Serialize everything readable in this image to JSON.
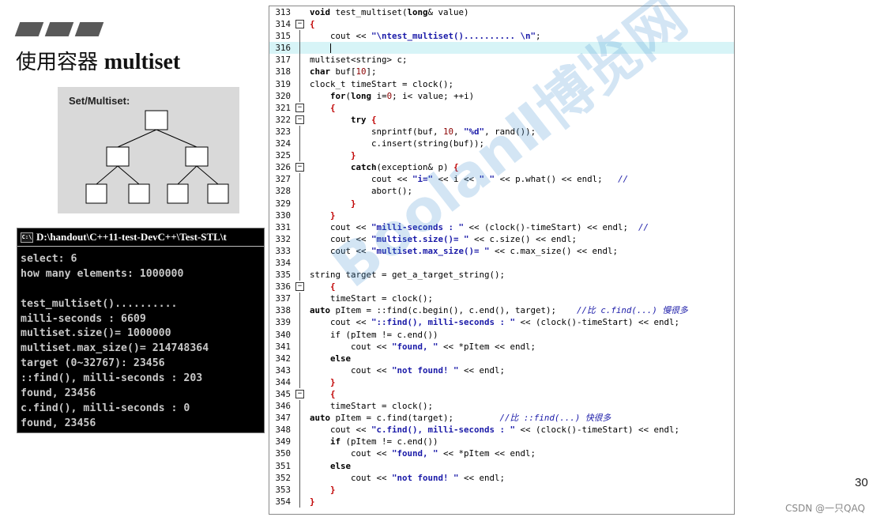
{
  "slide": {
    "title_cjk": "使用容器",
    "title_latin": "multiset",
    "page_number": "30",
    "credit": "CSDN @一只QAQ"
  },
  "diagram": {
    "title": "Set/Multiset:"
  },
  "console": {
    "title": "D:\\handout\\C++11-test-DevC++\\Test-STL\\t",
    "lines": [
      "select: 6",
      "how many elements: 1000000",
      "",
      "test_multiset()..........",
      "milli-seconds : 6609",
      "multiset.size()= 1000000",
      "multiset.max_size()= 214748364",
      "target (0~32767): 23456",
      "::find(), milli-seconds : 203",
      "found, 23456",
      "c.find(), milli-seconds : 0",
      "found, 23456"
    ]
  },
  "code": {
    "line_numbers": [
      "313",
      "314",
      "315",
      "316",
      "317",
      "318",
      "319",
      "320",
      "321",
      "322",
      "323",
      "324",
      "325",
      "326",
      "327",
      "328",
      "329",
      "330",
      "331",
      "332",
      "333",
      "334",
      "335",
      "336",
      "337",
      "338",
      "339",
      "340",
      "341",
      "342",
      "343",
      "344",
      "345",
      "346",
      "347",
      "348",
      "349",
      "350",
      "351",
      "352",
      "353",
      "354"
    ],
    "fold_mark": "−"
  },
  "watermark": "BoolanⅡ博览网"
}
